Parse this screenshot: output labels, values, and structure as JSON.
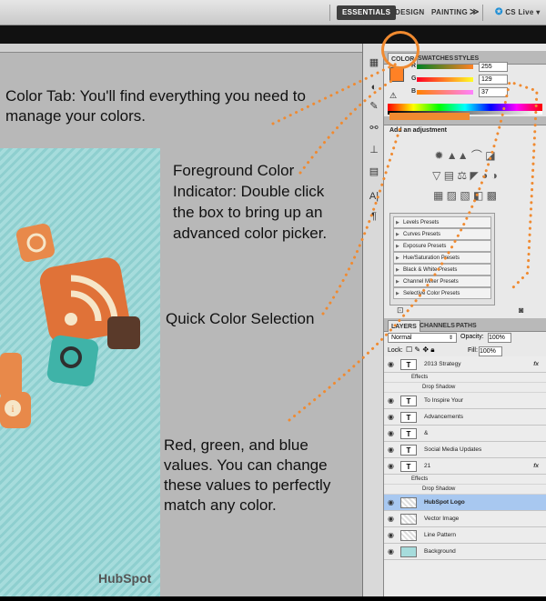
{
  "workspace": {
    "items": [
      "ESSENTIALS",
      "DESIGN",
      "PAINTING",
      "≫",
      "CS Live"
    ]
  },
  "annotations": {
    "color_tab": "Color Tab: You'll find everything you need to manage your colors.",
    "foreground": "Foreground Color Indicator: Double click the box to bring up an advanced color picker.",
    "quick": "Quick Color Selection",
    "rgb": "Red, green, and blue values. You can change these values to perfectly match any color."
  },
  "canvas": {
    "logo": "HubSpot"
  },
  "color_panel": {
    "tabs": [
      "COLOR",
      "SWATCHES",
      "STYLES"
    ],
    "channels": [
      {
        "label": "R",
        "value": "255"
      },
      {
        "label": "G",
        "value": "129"
      },
      {
        "label": "B",
        "value": "37"
      }
    ],
    "foreground_color": "#ff8125"
  },
  "adjustments": {
    "title": "Add an adjustment",
    "presets": [
      "Levels Presets",
      "Curves Presets",
      "Exposure Presets",
      "Hue/Saturation Presets",
      "Black & White Presets",
      "Channel Mixer Presets",
      "Selective Color Presets"
    ]
  },
  "layers_panel": {
    "tabs": [
      "LAYERS",
      "CHANNELS",
      "PATHS"
    ],
    "blend_mode": "Normal",
    "opacity_label": "Opacity:",
    "opacity": "100%",
    "lock_label": "Lock:",
    "fill_label": "Fill:",
    "fill": "100%",
    "effects_label": "Effects",
    "drop_shadow_label": "Drop Shadow",
    "layers": [
      {
        "name": "2013 Strategy",
        "thumb": "T",
        "fx": "fx"
      },
      {
        "name": "To Inspire Your",
        "thumb": "T"
      },
      {
        "name": "Advancements",
        "thumb": "T"
      },
      {
        "name": "&",
        "thumb": "T"
      },
      {
        "name": "Social Media Updates",
        "thumb": "T"
      },
      {
        "name": "21",
        "thumb": "T",
        "fx": "fx"
      },
      {
        "name": "HubSpot Logo",
        "thumb": "",
        "selected": true
      },
      {
        "name": "Vector Image",
        "thumb": ""
      },
      {
        "name": "Line Pattern",
        "thumb": ""
      },
      {
        "name": "Background",
        "thumb": ""
      }
    ]
  },
  "colors": {
    "accent": "#f08a30",
    "selected_layer": "#a8c8f0"
  }
}
